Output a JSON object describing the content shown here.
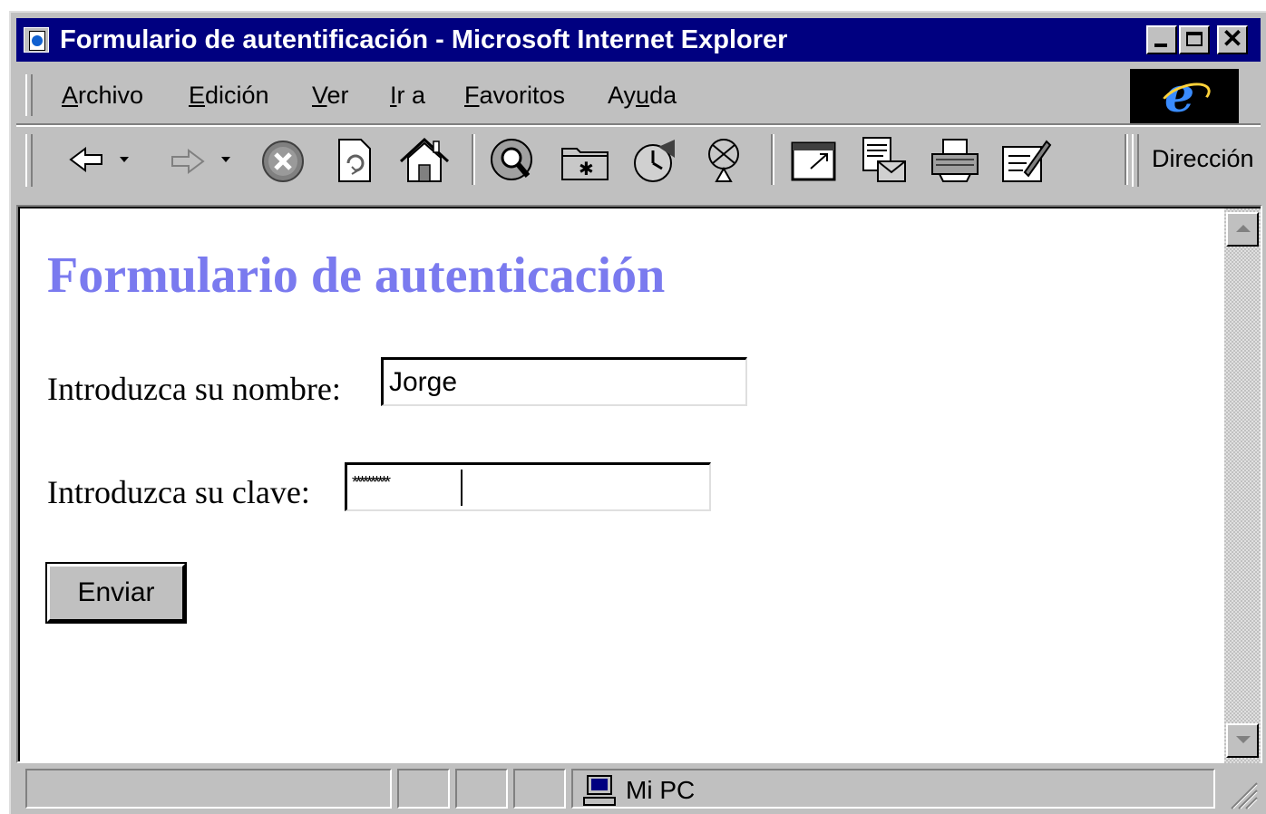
{
  "window": {
    "title": "Formulario de autentificación - Microsoft Internet Explorer",
    "controls": {
      "minimize": "minimize",
      "maximize": "maximize",
      "close": "✕"
    }
  },
  "menu": {
    "items": [
      {
        "pre": "",
        "ul": "A",
        "post": "rchivo"
      },
      {
        "pre": "",
        "ul": "E",
        "post": "dición"
      },
      {
        "pre": "",
        "ul": "V",
        "post": "er"
      },
      {
        "pre": "",
        "ul": "I",
        "post": "r a"
      },
      {
        "pre": "",
        "ul": "F",
        "post": "avoritos"
      },
      {
        "pre": "Ay",
        "ul": "u",
        "post": "da"
      }
    ]
  },
  "toolbar": {
    "buttons": [
      "back-arrow-icon",
      "forward-arrow-icon",
      "stop-icon",
      "refresh-icon",
      "home-icon",
      "search-icon",
      "favorites-icon",
      "history-icon",
      "channels-icon",
      "fullscreen-icon",
      "mail-icon",
      "print-icon",
      "edit-icon"
    ],
    "address_label": "Dirección"
  },
  "page": {
    "heading": "Formulario de autenticación",
    "name_label": "Introduzca su nombre:",
    "name_value": "Jorge",
    "password_label": "Introduzca su clave:",
    "password_mask": "**********",
    "submit_label": "Enviar"
  },
  "status": {
    "zone_text": "Mi PC",
    "zone_icon": "computer-icon"
  },
  "colors": {
    "titlebar": "#000080",
    "heading": "#7a7aef",
    "chrome": "#c0c0c0"
  }
}
